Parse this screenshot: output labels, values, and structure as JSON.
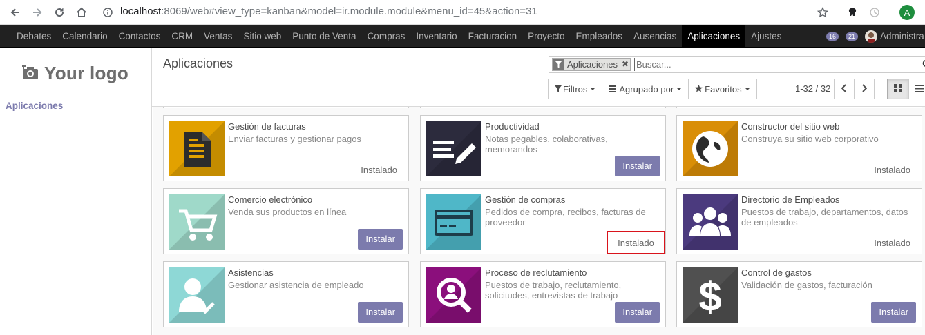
{
  "browser": {
    "url_host": "localhost",
    "url_path": ":8069/web#view_type=kanban&model=ir.module.module&menu_id=45&action=31",
    "profile_initial": "A"
  },
  "topmenu": {
    "items": [
      "Debates",
      "Calendario",
      "Contactos",
      "CRM",
      "Ventas",
      "Sitio web",
      "Punto de Venta",
      "Compras",
      "Inventario",
      "Facturacion",
      "Proyecto",
      "Empleados",
      "Ausencias",
      "Aplicaciones",
      "Ajustes"
    ],
    "active": "Aplicaciones",
    "messages_count": "16",
    "activities_count": "21",
    "user_name": "Administra"
  },
  "sidebar": {
    "logo_text": "Your logo",
    "link": "Aplicaciones"
  },
  "control_panel": {
    "breadcrumb": "Aplicaciones",
    "facet_label": "Aplicaciones",
    "search_placeholder": "Buscar...",
    "filters_label": "Filtros",
    "groupby_label": "Agrupado por",
    "favorites_label": "Favoritos",
    "pager": "1-32 / 32"
  },
  "apps": [
    {
      "title": "Gestión de facturas",
      "desc": "Enviar facturas y gestionar pagos",
      "status": "Instalado",
      "icon": "invoice-icon",
      "color": "#e2a100"
    },
    {
      "title": "Productividad",
      "desc": "Notas pegables, colaborativas, memorandos",
      "status": "Instalar",
      "icon": "notes-icon",
      "color": "#2c2b3d"
    },
    {
      "title": "Constructor del sitio web",
      "desc": "Construya su sitio web corporativo",
      "status": "Instalado",
      "icon": "globe-icon",
      "color": "#d98e07"
    },
    {
      "title": "Comercio electrónico",
      "desc": "Venda sus productos en línea",
      "status": "Instalar",
      "icon": "cart-icon",
      "color": "#9fd9c9"
    },
    {
      "title": "Gestión de compras",
      "desc": "Pedidos de compra, recibos, facturas de proveedor",
      "status": "Instalado",
      "icon": "credit-card-icon",
      "color": "#4fb7c8"
    },
    {
      "title": "Directorio de Empleados",
      "desc": "Puestos de trabajo, departamentos, datos de empleados",
      "status": "Instalado",
      "icon": "users-icon",
      "color": "#4b3a7e"
    },
    {
      "title": "Asistencias",
      "desc": "Gestionar asistencia de empleado",
      "status": "Instalar",
      "icon": "user-check-icon",
      "color": "#8ed8d6"
    },
    {
      "title": "Proceso de reclutamiento",
      "desc": "Puestos de trabajo, reclutamiento, solicitudes, entrevistas de trabajo",
      "status": "Instalar",
      "icon": "search-person-icon",
      "color": "#8b0f7c"
    },
    {
      "title": "Control de gastos",
      "desc": "Validación de gastos, facturación",
      "status": "Instalar",
      "icon": "dollar-icon",
      "color": "#505050"
    }
  ]
}
